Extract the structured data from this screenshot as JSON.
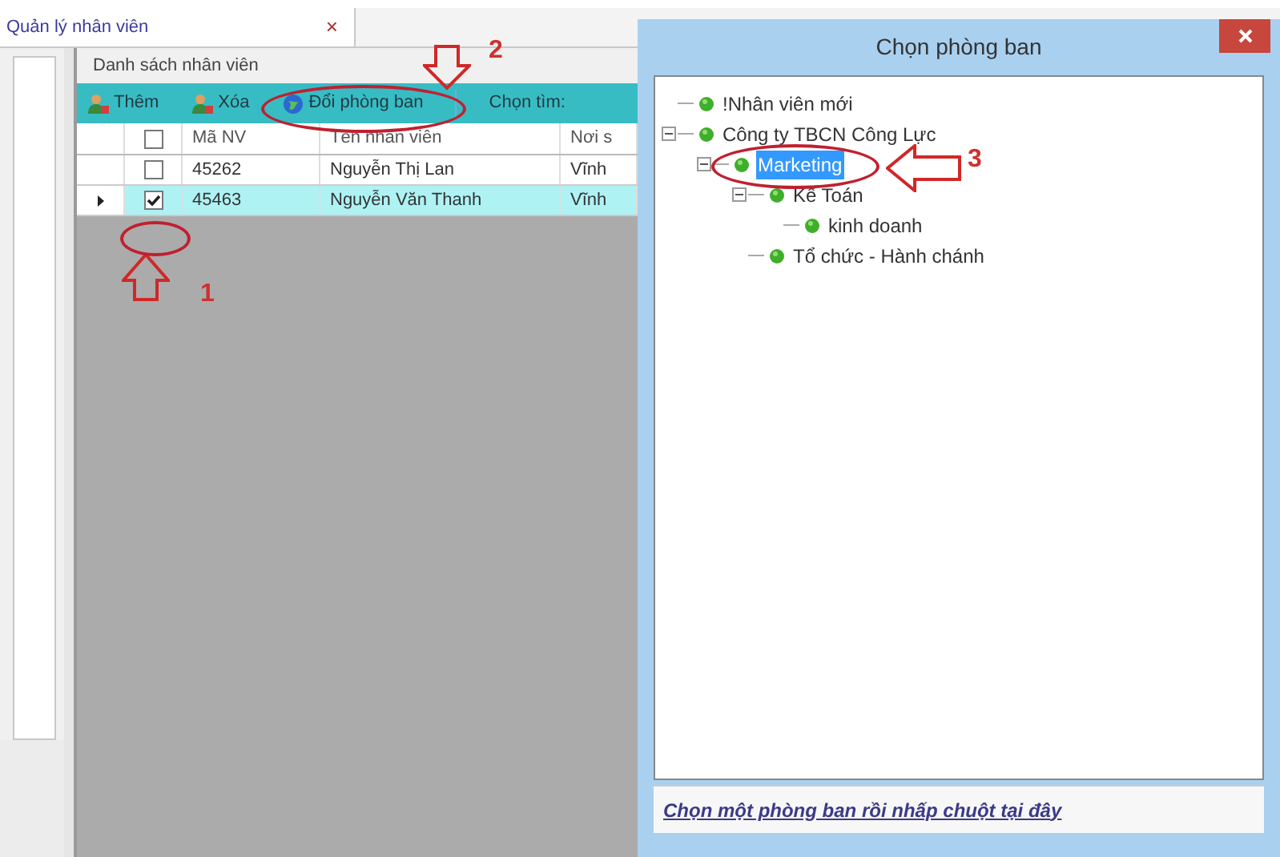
{
  "tab": {
    "title": "Quản lý nhân viên",
    "close": "×"
  },
  "list_title": "Danh sách nhân viên",
  "toolbar": [
    {
      "kind": "person",
      "label": "Thêm"
    },
    {
      "kind": "person",
      "label": "Xóa"
    },
    {
      "kind": "globe",
      "label": "Đổi phòng ban"
    },
    {
      "kind": "text",
      "label": "Chọn tìm:"
    }
  ],
  "table": {
    "header_checked": false,
    "columns": [
      "Mã NV",
      "Tên nhân viên",
      "Nơi s"
    ],
    "rows": [
      {
        "selected": false,
        "checked": false,
        "cells": [
          "45262",
          "Nguyễn Thị Lan",
          "Vĩnh"
        ]
      },
      {
        "selected": true,
        "checked": true,
        "cells": [
          "45463",
          "Nguyễn Văn Thanh",
          "Vĩnh"
        ]
      }
    ]
  },
  "dialog": {
    "title": "Chọn phòng ban",
    "tree": [
      {
        "label": "!Nhân viên mới",
        "selected": false
      },
      {
        "label": "Công ty TBCN Công Lực",
        "selected": false,
        "expanded": true,
        "children": [
          {
            "label": "Marketing",
            "selected": true,
            "expanded": true,
            "children": [
              {
                "label": "Kế Toán",
                "selected": false,
                "expanded": true,
                "children": [
                  {
                    "label": "kinh doanh",
                    "selected": false
                  }
                ]
              },
              {
                "label": "Tổ chức - Hành chánh",
                "selected": false
              }
            ]
          }
        ]
      }
    ],
    "footer_link": "Chọn một phòng ban rồi nhấp chuột tại đây"
  },
  "annotations": [
    {
      "kind": "down",
      "label": "2"
    },
    {
      "kind": "up",
      "label": "1"
    },
    {
      "kind": "left",
      "label": "3"
    }
  ]
}
